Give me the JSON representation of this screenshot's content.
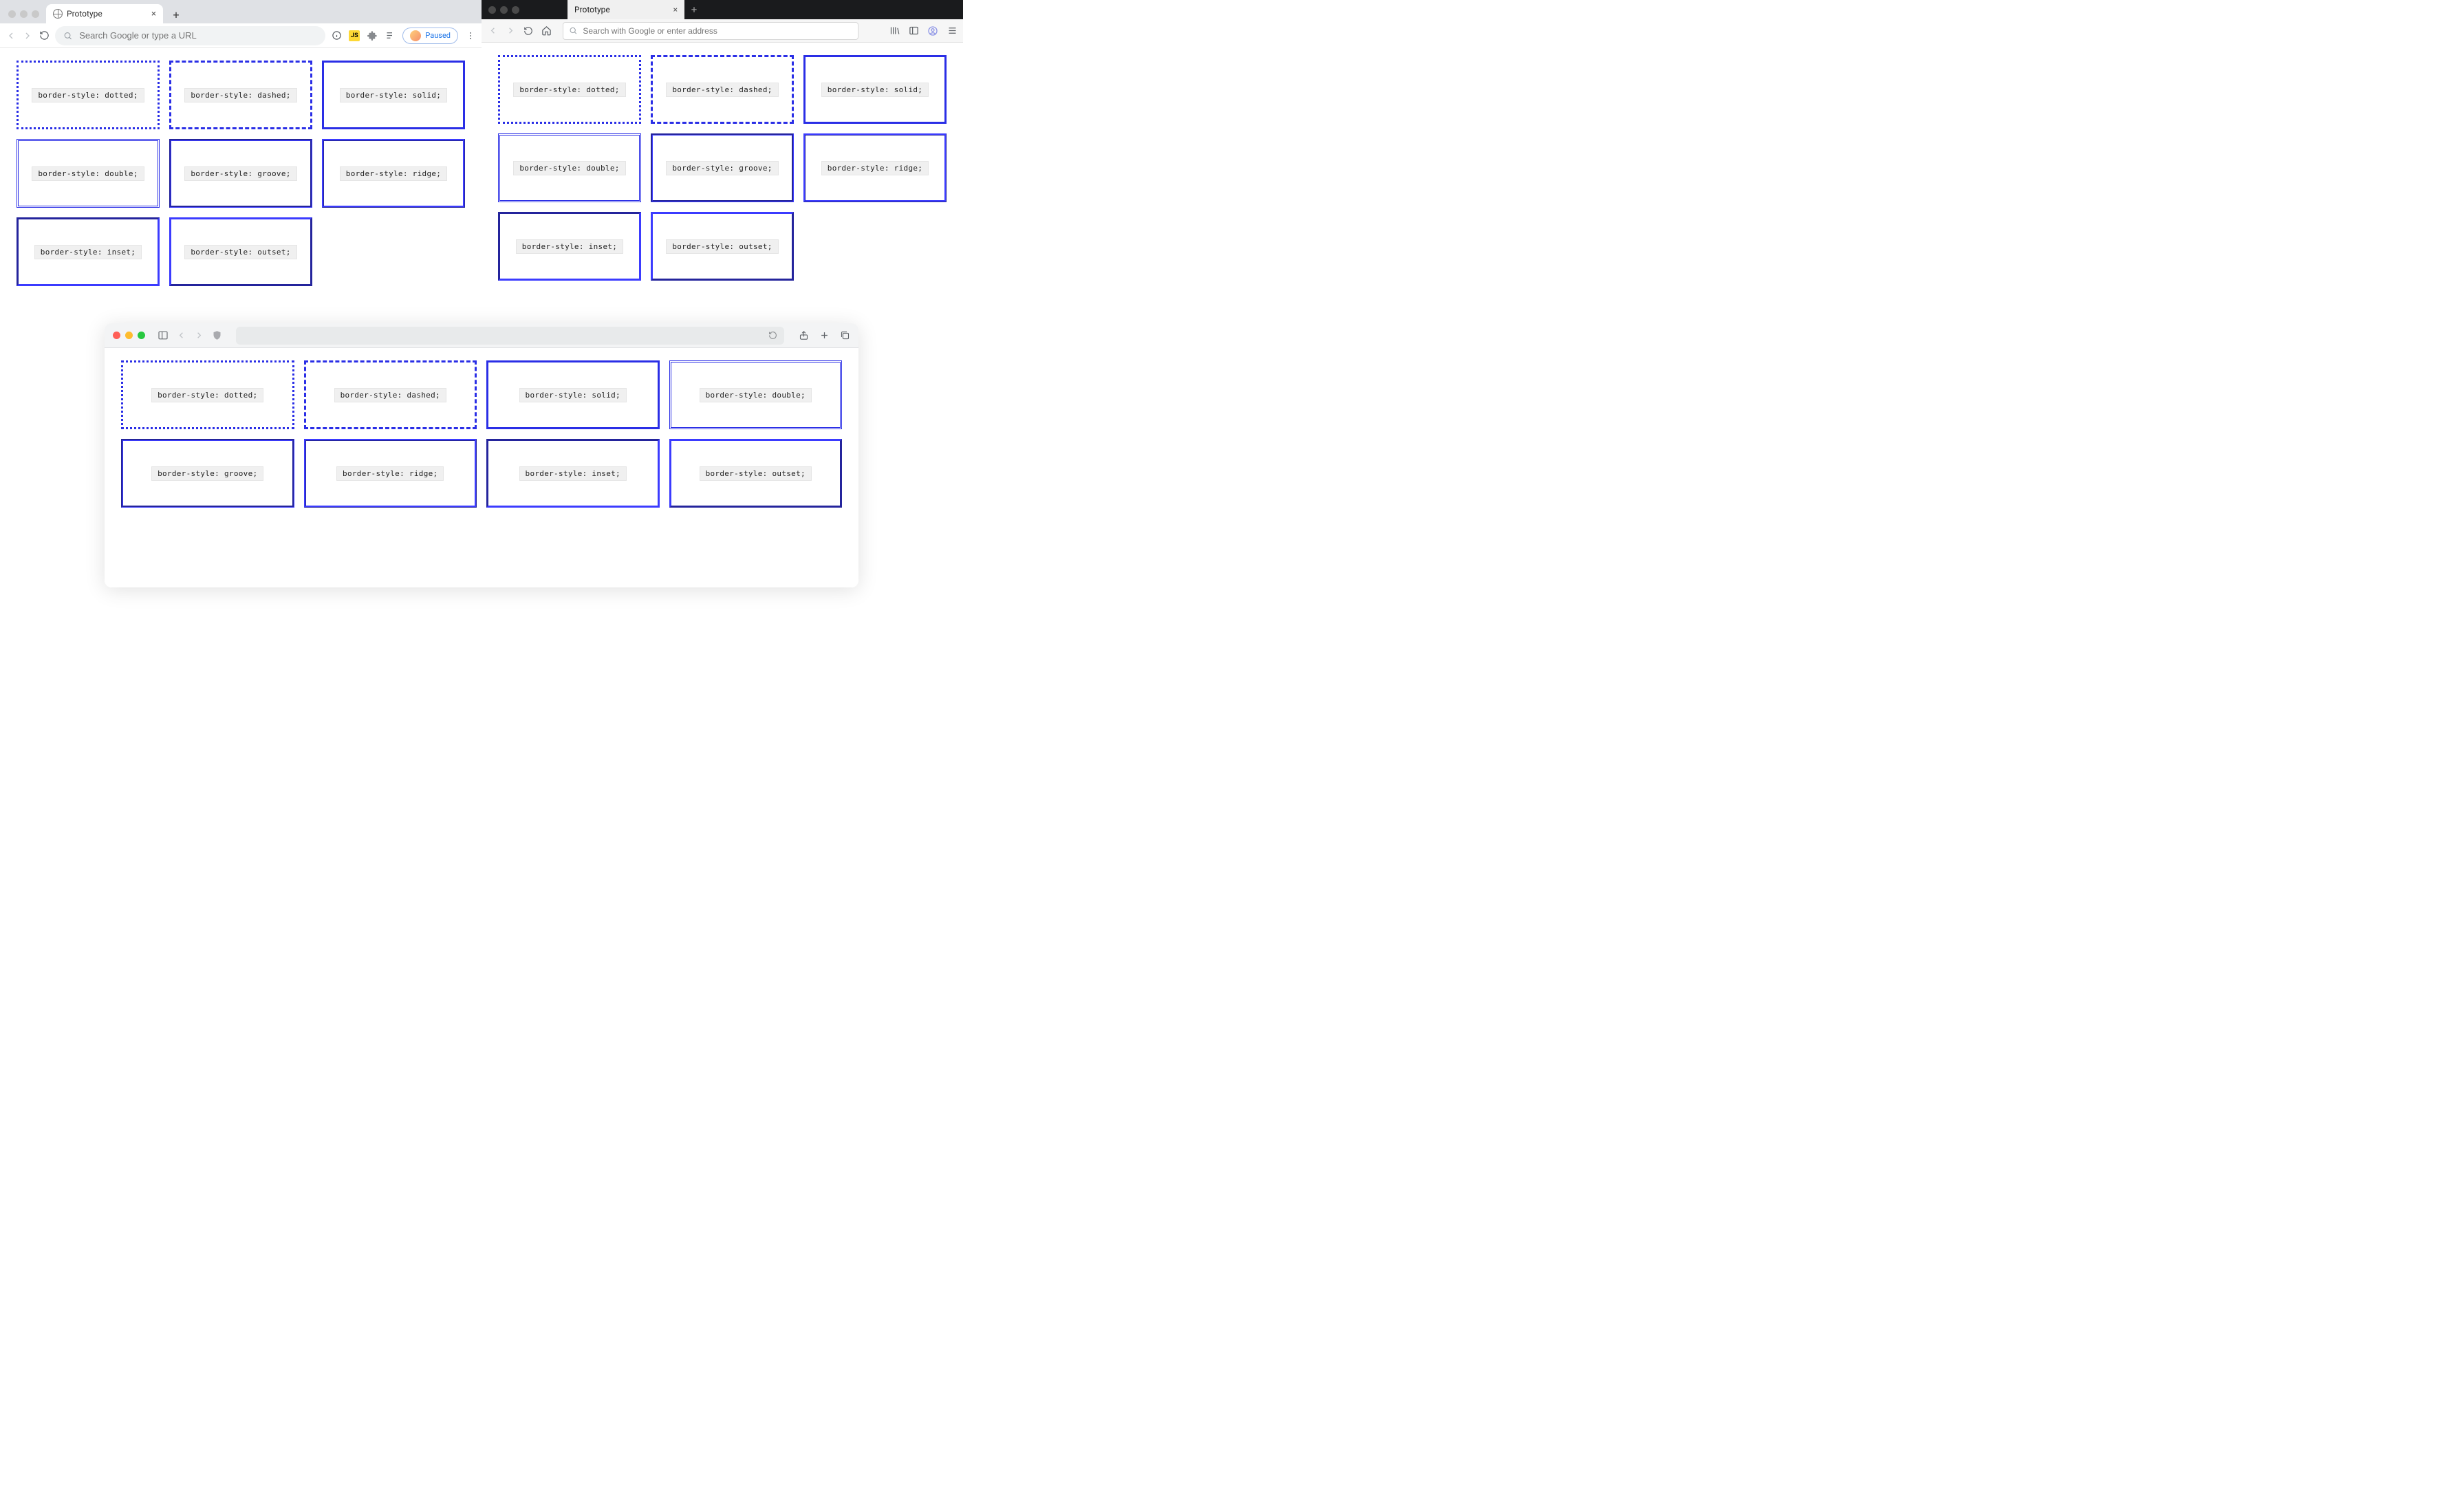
{
  "chrome": {
    "tab_title": "Prototype",
    "omnibox_placeholder": "Search Google or type a URL",
    "paused_label": "Paused",
    "boxes": [
      {
        "cls": "b-dotted",
        "label": "border-style: dotted;"
      },
      {
        "cls": "b-dashed",
        "label": "border-style: dashed;"
      },
      {
        "cls": "b-solid",
        "label": "border-style: solid;"
      },
      {
        "cls": "b-double",
        "label": "border-style: double;"
      },
      {
        "cls": "b-groove",
        "label": "border-style: groove;"
      },
      {
        "cls": "b-ridge",
        "label": "border-style: ridge;"
      },
      {
        "cls": "b-inset",
        "label": "border-style: inset;"
      },
      {
        "cls": "b-outset",
        "label": "border-style: outset;"
      }
    ]
  },
  "firefox": {
    "tab_title": "Prototype",
    "url_placeholder": "Search with Google or enter address",
    "boxes": [
      {
        "cls": "b-dotted",
        "label": "border-style: dotted;"
      },
      {
        "cls": "b-dashed",
        "label": "border-style: dashed;"
      },
      {
        "cls": "b-solid",
        "label": "border-style: solid;"
      },
      {
        "cls": "b-double",
        "label": "border-style: double;"
      },
      {
        "cls": "b-groove",
        "label": "border-style: groove;"
      },
      {
        "cls": "b-ridge",
        "label": "border-style: ridge;"
      },
      {
        "cls": "b-inset",
        "label": "border-style: inset;"
      },
      {
        "cls": "b-outset",
        "label": "border-style: outset;"
      }
    ]
  },
  "safari": {
    "boxes": [
      {
        "cls": "b-dotted",
        "label": "border-style: dotted;"
      },
      {
        "cls": "b-dashed",
        "label": "border-style: dashed;"
      },
      {
        "cls": "b-solid",
        "label": "border-style: solid;"
      },
      {
        "cls": "b-double",
        "label": "border-style: double;"
      },
      {
        "cls": "b-groove",
        "label": "border-style: groove;"
      },
      {
        "cls": "b-ridge",
        "label": "border-style: ridge;"
      },
      {
        "cls": "b-inset",
        "label": "border-style: inset;"
      },
      {
        "cls": "b-outset",
        "label": "border-style: outset;"
      }
    ]
  },
  "colors": {
    "border_blue": "#2a2ee6"
  }
}
